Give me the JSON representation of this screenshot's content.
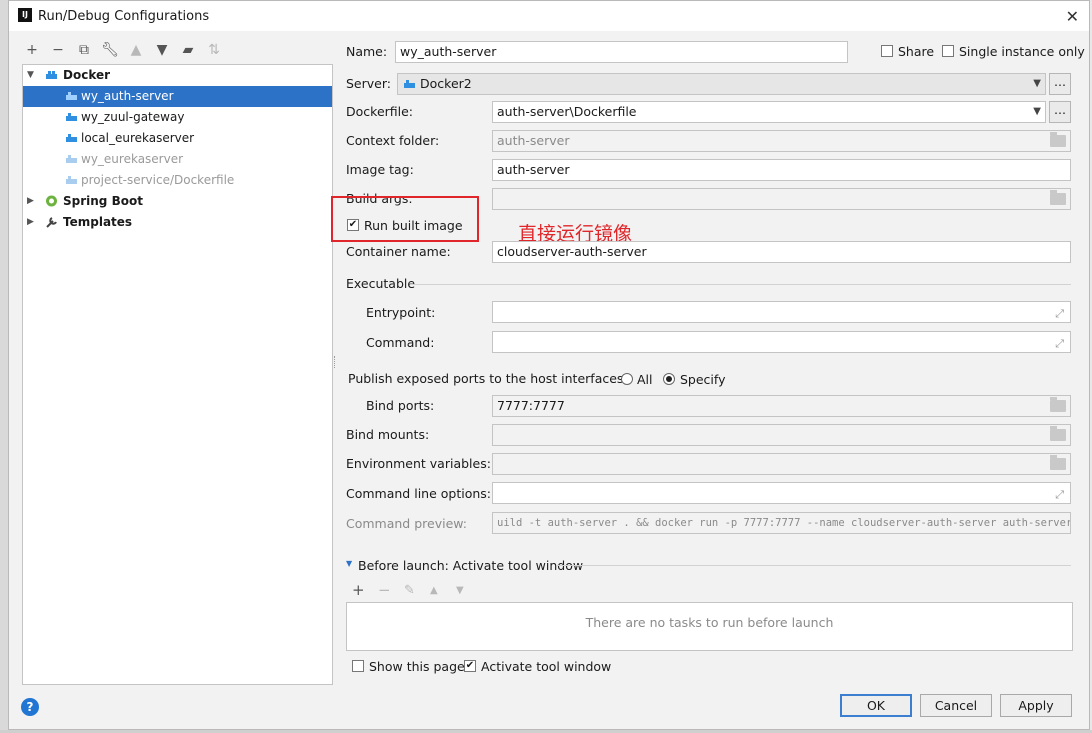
{
  "window": {
    "title": "Run/Debug Configurations"
  },
  "toolbar": {
    "icons": [
      "plus-icon",
      "minus-icon",
      "copy-icon",
      "wrench-icon",
      "arrow-up-icon",
      "arrow-down-icon",
      "new-folder-icon",
      "sort-icon"
    ]
  },
  "tree": {
    "docker": "Docker",
    "items": [
      "wy_auth-server",
      "wy_zuul-gateway",
      "local_eurekaserver",
      "wy_eurekaserver",
      "project-service/Dockerfile"
    ],
    "spring_boot": "Spring Boot",
    "templates": "Templates"
  },
  "form": {
    "name_label": "Name:",
    "name_value": "wy_auth-server",
    "share_label": "Share",
    "single_instance_label": "Single instance only",
    "server_label": "Server:",
    "server_value": "Docker2",
    "dockerfile_label": "Dockerfile:",
    "dockerfile_value": "auth-server\\Dockerfile",
    "context_label": "Context folder:",
    "context_value": "auth-server",
    "image_tag_label": "Image tag:",
    "image_tag_value": "auth-server",
    "build_args_label": "Build args:",
    "run_built_label": "Run built image",
    "run_built_checked": true,
    "container_label": "Container name:",
    "container_value": "cloudserver-auth-server",
    "executable_label": "Executable",
    "entrypoint_label": "Entrypoint:",
    "command_label": "Command:",
    "publish_label": "Publish exposed ports to the host interfaces:",
    "all_label": "All",
    "specify_label": "Specify",
    "bind_ports_label": "Bind ports:",
    "bind_ports_value": "7777:7777",
    "bind_mounts_label": "Bind mounts:",
    "env_label": "Environment variables:",
    "cmdline_label": "Command line options:",
    "preview_label": "Command preview:",
    "preview_value": "uild -t auth-server . && docker run -p 7777:7777 --name cloudserver-auth-server auth-server"
  },
  "annotation": "直接运行镜像",
  "before_launch": {
    "header": "Before launch: Activate tool window",
    "empty_text": "There are no tasks to run before launch",
    "show_page_label": "Show this page",
    "activate_label": "Activate tool window"
  },
  "buttons": {
    "ok": "OK",
    "cancel": "Cancel",
    "apply": "Apply",
    "help": "?"
  },
  "colors": {
    "selection": "#2c72c7",
    "annotation_red": "#e0262a",
    "default_button_border": "#3c7fd1"
  }
}
